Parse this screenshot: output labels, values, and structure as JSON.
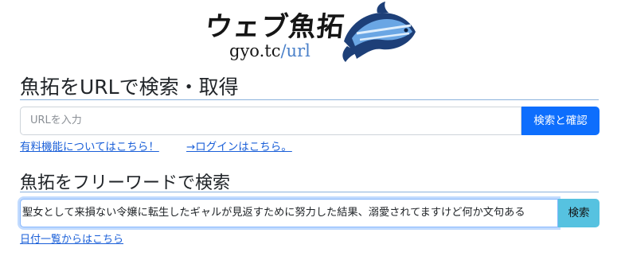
{
  "logo": {
    "title": "ウェブ魚拓",
    "domain": "gyo.tc",
    "path": "/url",
    "fish_color": "#3f7fd0"
  },
  "url_section": {
    "heading": "魚拓をURLで検索・取得",
    "input_placeholder": "URLを入力",
    "button_label": "検索と確認",
    "link_premium": "有料機能についてはこちら！",
    "link_login": "→ログインはこちら。"
  },
  "free_section": {
    "heading": "魚拓をフリーワードで検索",
    "input_value": "聖女として来損ない令嬢に転生したギャルが見返すために努力した結果、溺愛されてますけど何か文句ある",
    "button_label": "検索",
    "link_dates": "日付一覧からはこちら"
  },
  "colors": {
    "primary": "#0d6efd",
    "info": "#56c2e0",
    "link": "#1a5fd8"
  }
}
